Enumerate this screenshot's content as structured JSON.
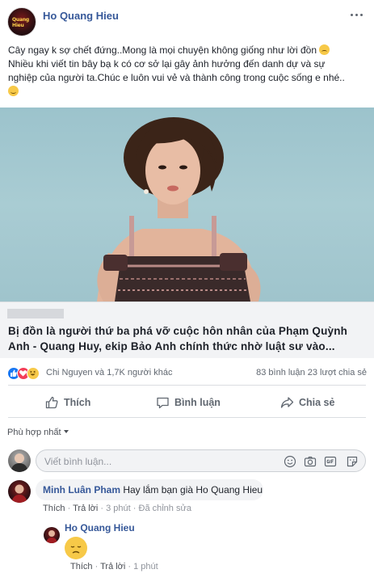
{
  "post": {
    "author": "Ho Quang Hieu",
    "avatar_text": "Quang Hieu",
    "text_line1": "Cây ngay k sợ chết đứng..Mong là mọi chuyện không giống như lời đồn",
    "text_line2": "Nhiều khi viết tin bây bạ k có cơ sở lại gây ảnh hưởng đến danh dự và sự",
    "text_line3": "nghiệp của người ta.Chúc e luôn vui vẻ và thành công trong cuộc sống e nhé.."
  },
  "link_card": {
    "title_line1": "Bị đồn là người thứ ba phá vỡ cuộc hôn nhân của Phạm Quỳnh",
    "title_line2": "Anh - Quang Huy, ekip Bảo Anh chính thức nhờ luật sư vào..."
  },
  "reactions": {
    "names": "Chi Nguyen và 1,7K người khác",
    "counts": "83 bình luận  23 lượt chia sẻ",
    "icons": [
      "like-reaction",
      "love-reaction",
      "haha-reaction"
    ]
  },
  "actions": {
    "like": "Thích",
    "comment": "Bình luận",
    "share": "Chia sẻ"
  },
  "sort_label": "Phù hợp nhất",
  "comment_input": {
    "placeholder": "Viết bình luận..."
  },
  "comments": [
    {
      "author": "Minh Luân Pham",
      "text": "Hay lắm bạn già Ho Quang Hieu",
      "like": "Thích",
      "reply": "Trả lời",
      "time": "3 phút",
      "edited": "Đã chỉnh sửa"
    },
    {
      "author": "Ho Quang Hieu",
      "like": "Thích",
      "reply": "Trả lời",
      "time": "1 phút"
    }
  ],
  "colors": {
    "link": "#365899",
    "meta": "#90949c",
    "like_blue": "#1877f2",
    "love_red": "#f33e58",
    "emoji_yellow": "#f7c948"
  }
}
